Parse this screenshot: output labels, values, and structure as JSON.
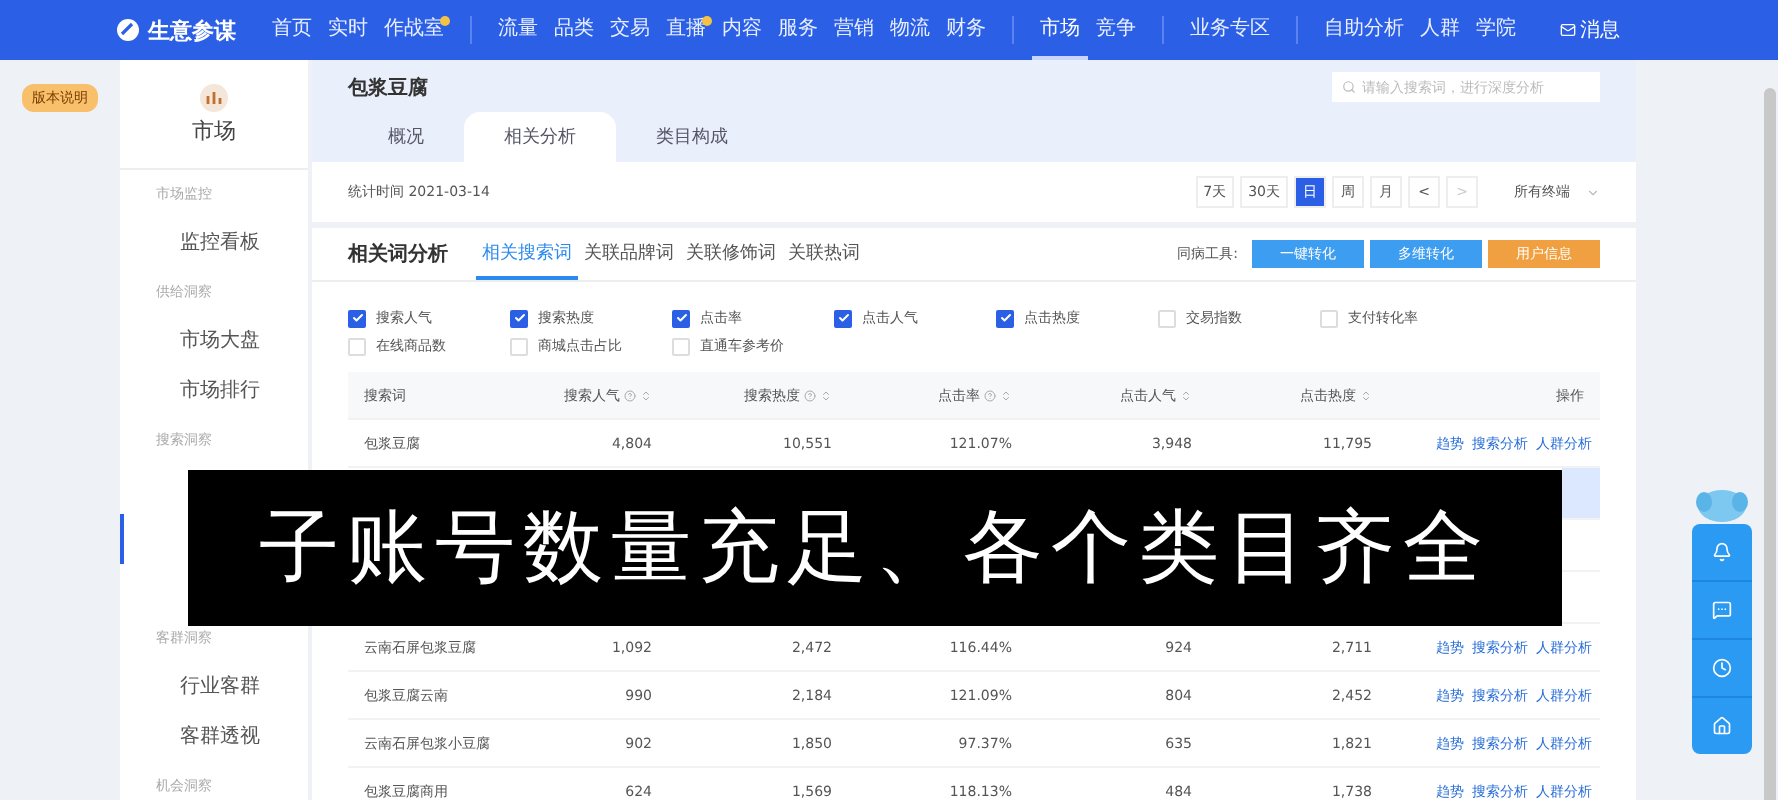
{
  "nav": {
    "brand": "生意参谋",
    "items": [
      {
        "label": "首页",
        "selected": false,
        "dot": false,
        "divider_before": false
      },
      {
        "label": "实时",
        "selected": false,
        "dot": false,
        "divider_before": false
      },
      {
        "label": "作战室",
        "selected": false,
        "dot": true,
        "divider_before": false
      },
      {
        "label": "流量",
        "selected": false,
        "dot": false,
        "divider_before": true
      },
      {
        "label": "品类",
        "selected": false,
        "dot": false,
        "divider_before": false
      },
      {
        "label": "交易",
        "selected": false,
        "dot": false,
        "divider_before": false
      },
      {
        "label": "直播",
        "selected": false,
        "dot": true,
        "divider_before": false
      },
      {
        "label": "内容",
        "selected": false,
        "dot": false,
        "divider_before": false
      },
      {
        "label": "服务",
        "selected": false,
        "dot": false,
        "divider_before": false
      },
      {
        "label": "营销",
        "selected": false,
        "dot": false,
        "divider_before": false
      },
      {
        "label": "物流",
        "selected": false,
        "dot": false,
        "divider_before": false
      },
      {
        "label": "财务",
        "selected": false,
        "dot": false,
        "divider_before": false
      },
      {
        "label": "市场",
        "selected": true,
        "dot": false,
        "divider_before": true
      },
      {
        "label": "竞争",
        "selected": false,
        "dot": false,
        "divider_before": false
      },
      {
        "label": "业务专区",
        "selected": false,
        "dot": false,
        "divider_before": true
      },
      {
        "label": "自助分析",
        "selected": false,
        "dot": false,
        "divider_before": true
      },
      {
        "label": "人群",
        "selected": false,
        "dot": false,
        "divider_before": false
      },
      {
        "label": "学院",
        "selected": false,
        "dot": false,
        "divider_before": false
      }
    ],
    "message": "消息"
  },
  "version_badge": "版本说明",
  "sidebar": {
    "title": "市场",
    "sections": [
      {
        "heading": "市场监控",
        "items": [
          {
            "label": "监控看板",
            "selected": false
          }
        ]
      },
      {
        "heading": "供给洞察",
        "items": [
          {
            "label": "市场大盘",
            "selected": false
          },
          {
            "label": "市场排行",
            "selected": false
          }
        ]
      },
      {
        "heading": "搜索洞察",
        "items": [
          {
            "kind": "covered",
            "selected": false
          },
          {
            "kind": "covered",
            "selected": true
          },
          {
            "kind": "covered",
            "selected": false
          }
        ]
      },
      {
        "heading": "客群洞察",
        "items": [
          {
            "label": "行业客群",
            "selected": false
          },
          {
            "label": "客群透视",
            "selected": false
          }
        ]
      },
      {
        "heading": "机会洞察"
      }
    ]
  },
  "header": {
    "title": "包浆豆腐",
    "search": {
      "placeholder": "请输入搜索词，进行深度分析"
    },
    "tabs": [
      {
        "label": "概况",
        "selected": false
      },
      {
        "label": "相关分析",
        "selected": true
      },
      {
        "label": "类目构成",
        "selected": false
      }
    ]
  },
  "date_bar": {
    "label": "统计时间 2021-03-14",
    "ranges": [
      {
        "label": "7天",
        "selected": false
      },
      {
        "label": "30天",
        "selected": false
      },
      {
        "label": "日",
        "selected": true
      },
      {
        "label": "周",
        "selected": false
      },
      {
        "label": "月",
        "selected": false
      }
    ],
    "prev": "<",
    "next": ">",
    "channel": "所有终端"
  },
  "analysis": {
    "title": "相关词分析",
    "tabs": [
      {
        "label": "相关搜索词",
        "selected": true
      },
      {
        "label": "关联品牌词",
        "selected": false
      },
      {
        "label": "关联修饰词",
        "selected": false
      },
      {
        "label": "关联热词",
        "selected": false
      }
    ],
    "tools_label": "同病工具:",
    "tools": [
      {
        "label": "一键转化",
        "kind": "primary"
      },
      {
        "label": "多维转化",
        "kind": "primary"
      },
      {
        "label": "用户信息",
        "kind": "warning"
      }
    ],
    "metrics": [
      {
        "label": "搜索人气",
        "checked": true
      },
      {
        "label": "搜索热度",
        "checked": true
      },
      {
        "label": "点击率",
        "checked": true
      },
      {
        "label": "点击人气",
        "checked": true
      },
      {
        "label": "点击热度",
        "checked": true
      },
      {
        "label": "交易指数",
        "checked": false
      },
      {
        "label": "支付转化率",
        "checked": false
      },
      {
        "label": "在线商品数",
        "checked": false
      },
      {
        "label": "商城点击占比",
        "checked": false
      },
      {
        "label": "直通车参考价",
        "checked": false
      }
    ]
  },
  "table": {
    "columns": [
      {
        "label": "搜索词",
        "info": false,
        "sort": false
      },
      {
        "label": "搜索人气",
        "info": true,
        "sort": true
      },
      {
        "label": "搜索热度",
        "info": true,
        "sort": true
      },
      {
        "label": "点击率",
        "info": true,
        "sort": true
      },
      {
        "label": "点击人气",
        "info": false,
        "sort": true
      },
      {
        "label": "点击热度",
        "info": false,
        "sort": true
      },
      {
        "label": "操作",
        "info": false,
        "sort": false
      }
    ],
    "rows": [
      {
        "kind": "full",
        "selected": false,
        "cells": [
          "包浆豆腐",
          "4,804",
          "10,551",
          "121.07%",
          "3,948",
          "11,795"
        ],
        "actions": [
          "趋势",
          "搜索分析",
          "人群分析"
        ]
      },
      {
        "kind": "covered",
        "selected": true
      },
      {
        "kind": "covered",
        "selected": false
      },
      {
        "kind": "covered",
        "selected": false
      },
      {
        "kind": "full",
        "selected": false,
        "cells": [
          "云南石屏包浆豆腐",
          "1,092",
          "2,472",
          "116.44%",
          "924",
          "2,711"
        ],
        "actions": [
          "趋势",
          "搜索分析",
          "人群分析"
        ]
      },
      {
        "kind": "full",
        "selected": false,
        "cells": [
          "包浆豆腐云南",
          "990",
          "2,184",
          "121.09%",
          "804",
          "2,452"
        ],
        "actions": [
          "趋势",
          "搜索分析",
          "人群分析"
        ]
      },
      {
        "kind": "full",
        "selected": false,
        "cells": [
          "云南石屏包浆小豆腐",
          "902",
          "1,850",
          "97.37%",
          "635",
          "1,821"
        ],
        "actions": [
          "趋势",
          "搜索分析",
          "人群分析"
        ]
      },
      {
        "kind": "full",
        "selected": false,
        "cells": [
          "包浆豆腐商用",
          "624",
          "1,569",
          "118.13%",
          "484",
          "1,738"
        ],
        "actions": [
          "趋势",
          "搜索分析",
          "人群分析"
        ]
      }
    ]
  },
  "banner": "子账号数量充足、各个类目齐全"
}
